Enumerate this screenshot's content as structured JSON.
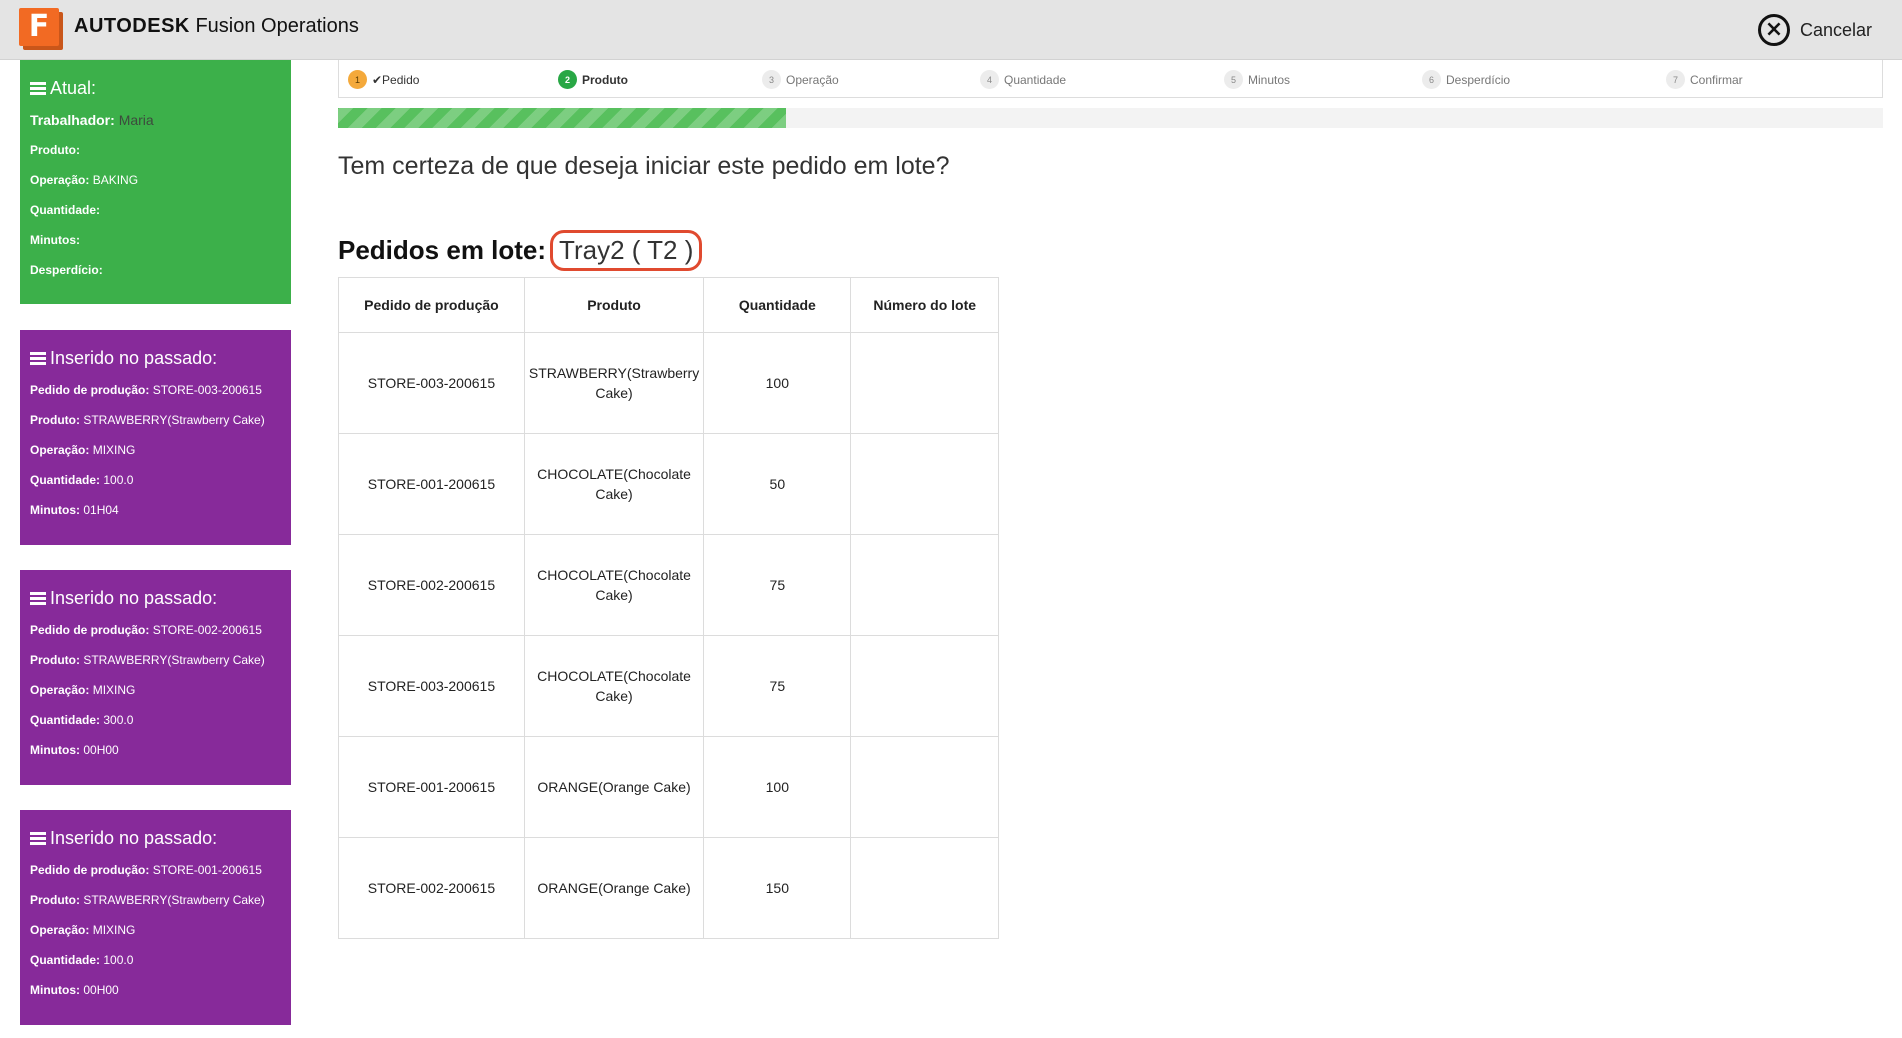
{
  "app": {
    "logo_letter": "F",
    "brand": "AUTODESK",
    "product": "Fusion Operations"
  },
  "header": {
    "cancel_label": "Cancelar"
  },
  "steps": [
    {
      "num": "1",
      "label": "✔Pedido",
      "state": "done"
    },
    {
      "num": "2",
      "label": "Produto",
      "state": "active"
    },
    {
      "num": "3",
      "label": "Operação",
      "state": "pending"
    },
    {
      "num": "4",
      "label": "Quantidade",
      "state": "pending"
    },
    {
      "num": "5",
      "label": "Minutos",
      "state": "pending"
    },
    {
      "num": "6",
      "label": "Desperdício",
      "state": "pending"
    },
    {
      "num": "7",
      "label": "Confirmar",
      "state": "pending"
    }
  ],
  "progress_fraction": 0.29,
  "current": {
    "title": "Atual:",
    "worker_label": "Trabalhador:",
    "worker_value": "Maria",
    "product_label": "Produto:",
    "product_value": "",
    "operation_label": "Operação:",
    "operation_value": "BAKING",
    "quantity_label": "Quantidade:",
    "quantity_value": "",
    "minutes_label": "Minutos:",
    "minutes_value": "",
    "waste_label": "Desperdício:",
    "waste_value": ""
  },
  "past_entries": [
    {
      "title": "Inserido no passado:",
      "order_label": "Pedido de produção:",
      "order": "STORE-003-200615",
      "product_label": "Produto:",
      "product": "STRAWBERRY(Strawberry Cake)",
      "operation_label": "Operação:",
      "operation": "MIXING",
      "quantity_label": "Quantidade:",
      "quantity": "100.0",
      "minutes_label": "Minutos:",
      "minutes": "01H04"
    },
    {
      "title": "Inserido no passado:",
      "order_label": "Pedido de produção:",
      "order": "STORE-002-200615",
      "product_label": "Produto:",
      "product": "STRAWBERRY(Strawberry Cake)",
      "operation_label": "Operação:",
      "operation": "MIXING",
      "quantity_label": "Quantidade:",
      "quantity": "300.0",
      "minutes_label": "Minutos:",
      "minutes": "00H00"
    },
    {
      "title": "Inserido no passado:",
      "order_label": "Pedido de produção:",
      "order": "STORE-001-200615",
      "product_label": "Produto:",
      "product": "STRAWBERRY(Strawberry Cake)",
      "operation_label": "Operação:",
      "operation": "MIXING",
      "quantity_label": "Quantidade:",
      "quantity": "100.0",
      "minutes_label": "Minutos:",
      "minutes": "00H00"
    }
  ],
  "main": {
    "question": "Tem certeza de que deseja iniciar este pedido em lote?",
    "batch_label": "Pedidos em lote:",
    "batch_value": "Tray2 ( T2 )",
    "table": {
      "headers": [
        "Pedido de produção",
        "Produto",
        "Quantidade",
        "Número do lote"
      ],
      "rows": [
        [
          "STORE-003-200615",
          "STRAWBERRY(Strawberry Cake)",
          "100",
          ""
        ],
        [
          "STORE-001-200615",
          "CHOCOLATE(Chocolate Cake)",
          "50",
          ""
        ],
        [
          "STORE-002-200615",
          "CHOCOLATE(Chocolate Cake)",
          "75",
          ""
        ],
        [
          "STORE-003-200615",
          "CHOCOLATE(Chocolate Cake)",
          "75",
          ""
        ],
        [
          "STORE-001-200615",
          "ORANGE(Orange Cake)",
          "100",
          ""
        ],
        [
          "STORE-002-200615",
          "ORANGE(Orange Cake)",
          "150",
          ""
        ]
      ]
    }
  },
  "colors": {
    "current_card": "#3cb04a",
    "past_card": "#872a9a",
    "highlight_ring": "#e04a2f",
    "progress": "#58c05e"
  }
}
